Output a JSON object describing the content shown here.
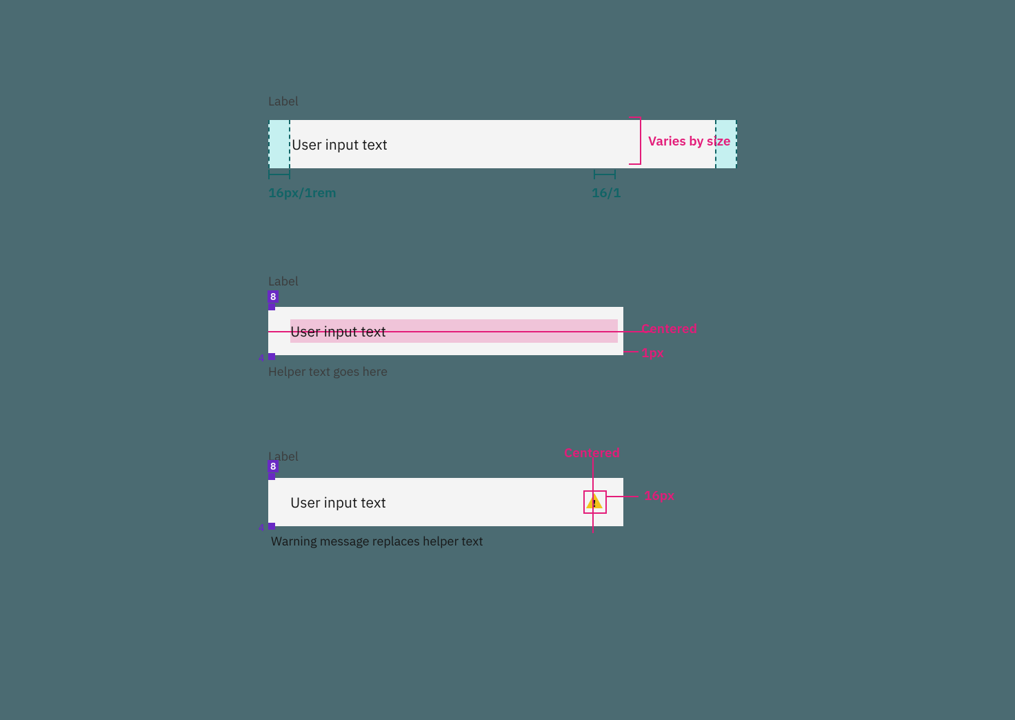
{
  "spec1": {
    "label": "Label",
    "input_text": "User input text",
    "height_note": "Varies by size",
    "pad_left_note": "16px/1rem",
    "pad_right_note": "16/1"
  },
  "spec2": {
    "label": "Label",
    "input_text": "User input text",
    "helper": "Helper text goes here",
    "gap_top_badge": "8",
    "gap_bottom_badge": "4",
    "centered_note": "Centered",
    "border_note": "1px"
  },
  "spec3": {
    "label": "Label",
    "input_text": "User input text",
    "message": "Warning message replaces helper text",
    "gap_top_badge": "8",
    "gap_bottom_badge": "4",
    "centered_note": "Centered",
    "icon_note": "16px",
    "icon_name": "warning-icon"
  }
}
